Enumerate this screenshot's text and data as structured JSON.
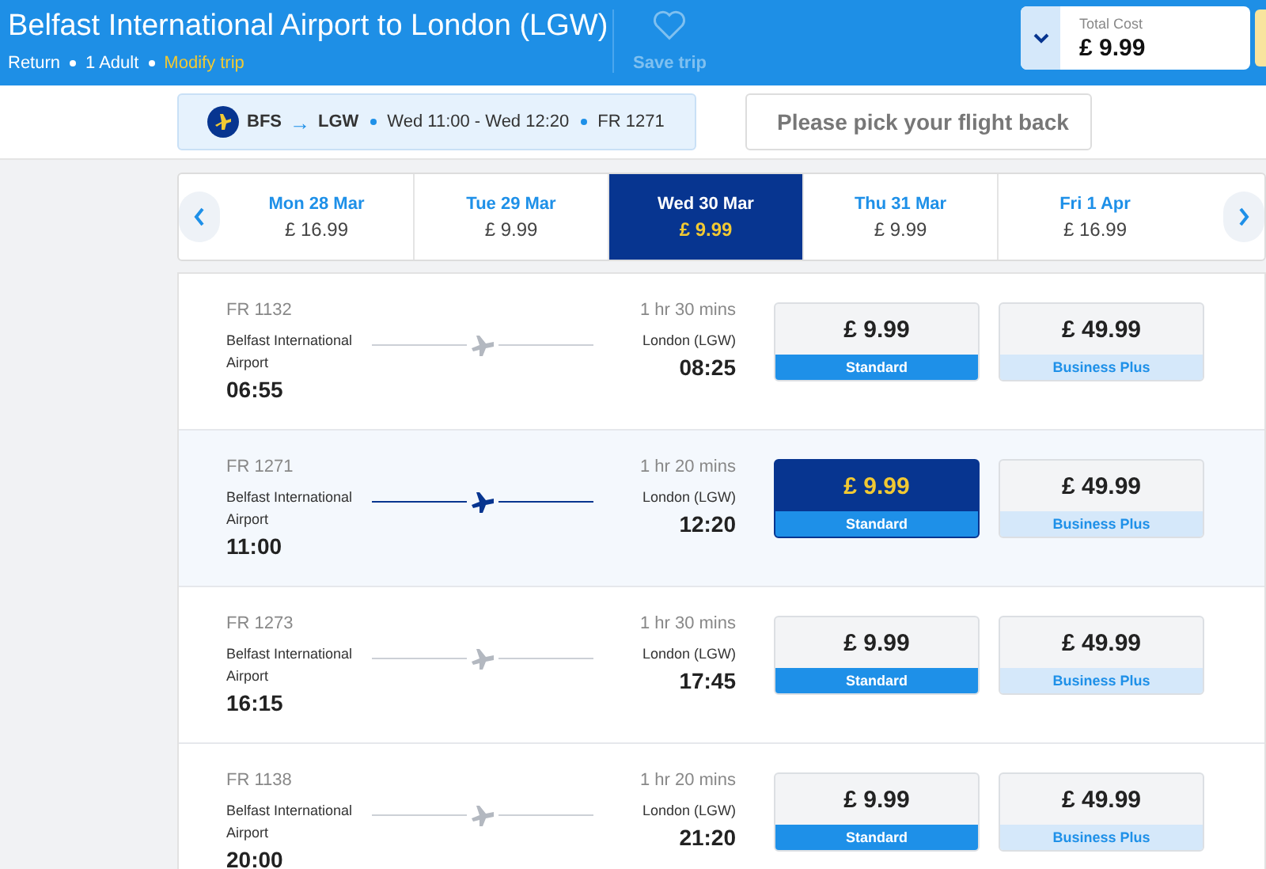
{
  "header": {
    "title": "Belfast International Airport to London (LGW)",
    "trip_type": "Return",
    "passengers": "1 Adult",
    "modify_link": "Modify trip",
    "save_label": "Save trip",
    "total_label": "Total Cost",
    "total_value": "£ 9.99"
  },
  "summary": {
    "from": "BFS",
    "arrow": "→",
    "to": "LGW",
    "times": "Wed 11:00 - Wed 12:20",
    "flight": "FR 1271"
  },
  "return_field": {
    "placeholder": "Please pick your flight back"
  },
  "dates": [
    {
      "day": "Mon 28 Mar",
      "price": "£ 16.99",
      "selected": false
    },
    {
      "day": "Tue 29 Mar",
      "price": "£ 9.99",
      "selected": false
    },
    {
      "day": "Wed 30 Mar",
      "price": "£ 9.99",
      "selected": true
    },
    {
      "day": "Thu 31 Mar",
      "price": "£ 9.99",
      "selected": false
    },
    {
      "day": "Fri 1 Apr",
      "price": "£ 16.99",
      "selected": false
    }
  ],
  "flights": [
    {
      "number": "FR 1132",
      "origin": "Belfast International Airport",
      "depart": "06:55",
      "duration": "1 hr 30 mins",
      "destination": "London (LGW)",
      "arrive": "08:25",
      "selected": false,
      "fares": [
        {
          "price": "£ 9.99",
          "label": "Standard",
          "kind": "standard",
          "selected": false
        },
        {
          "price": "£ 49.99",
          "label": "Business Plus",
          "kind": "business",
          "selected": false
        }
      ]
    },
    {
      "number": "FR 1271",
      "origin": "Belfast International Airport",
      "depart": "11:00",
      "duration": "1 hr 20 mins",
      "destination": "London (LGW)",
      "arrive": "12:20",
      "selected": true,
      "fares": [
        {
          "price": "£ 9.99",
          "label": "Standard",
          "kind": "standard",
          "selected": true
        },
        {
          "price": "£ 49.99",
          "label": "Business Plus",
          "kind": "business",
          "selected": false
        }
      ]
    },
    {
      "number": "FR 1273",
      "origin": "Belfast International Airport",
      "depart": "16:15",
      "duration": "1 hr 30 mins",
      "destination": "London (LGW)",
      "arrive": "17:45",
      "selected": false,
      "fares": [
        {
          "price": "£ 9.99",
          "label": "Standard",
          "kind": "standard",
          "selected": false
        },
        {
          "price": "£ 49.99",
          "label": "Business Plus",
          "kind": "business",
          "selected": false
        }
      ]
    },
    {
      "number": "FR 1138",
      "origin": "Belfast International Airport",
      "depart": "20:00",
      "duration": "1 hr 20 mins",
      "destination": "London (LGW)",
      "arrive": "21:20",
      "selected": false,
      "fares": [
        {
          "price": "£ 9.99",
          "label": "Standard",
          "kind": "standard",
          "selected": false
        },
        {
          "price": "£ 49.99",
          "label": "Business Plus",
          "kind": "business",
          "selected": false
        }
      ]
    }
  ]
}
